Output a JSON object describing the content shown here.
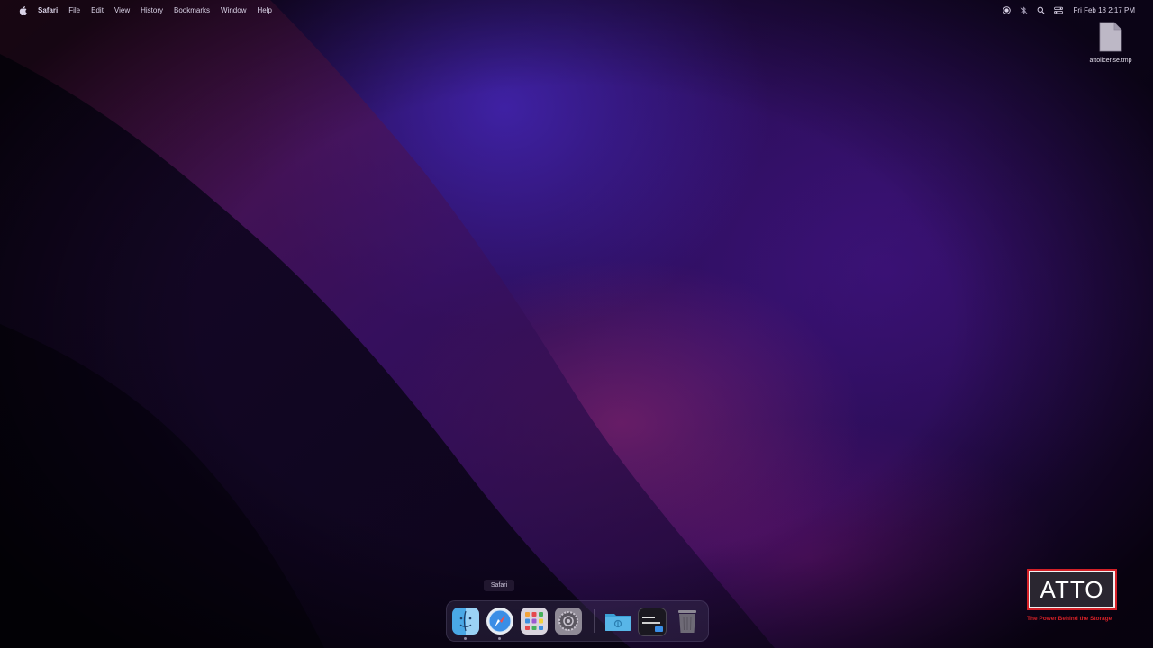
{
  "menubar": {
    "items": [
      "Safari",
      "File",
      "Edit",
      "View",
      "History",
      "Bookmarks",
      "Window",
      "Help"
    ],
    "clock": "Fri Feb 18  2:17 PM",
    "status_icons": [
      "record-icon",
      "bluetooth-off-icon",
      "spotlight-search-icon",
      "control-center-icon"
    ]
  },
  "desktop": {
    "files": [
      {
        "label": "attolicense.tmp",
        "icon": "document-icon"
      }
    ]
  },
  "dock": {
    "tooltip": "Safari",
    "items": [
      {
        "name": "finder",
        "icon": "finder-icon"
      },
      {
        "name": "safari",
        "icon": "safari-icon"
      },
      {
        "name": "launchpad",
        "icon": "launchpad-icon"
      },
      {
        "name": "system-preferences",
        "icon": "gear-icon"
      },
      {
        "name": "downloads",
        "icon": "folder-icon"
      },
      {
        "name": "terminal",
        "icon": "terminal-icon"
      },
      {
        "name": "trash",
        "icon": "trash-icon"
      }
    ]
  },
  "brand": {
    "logo_text": "ATTO",
    "tagline": "The Power Behind the Storage",
    "color": "#d42027"
  }
}
